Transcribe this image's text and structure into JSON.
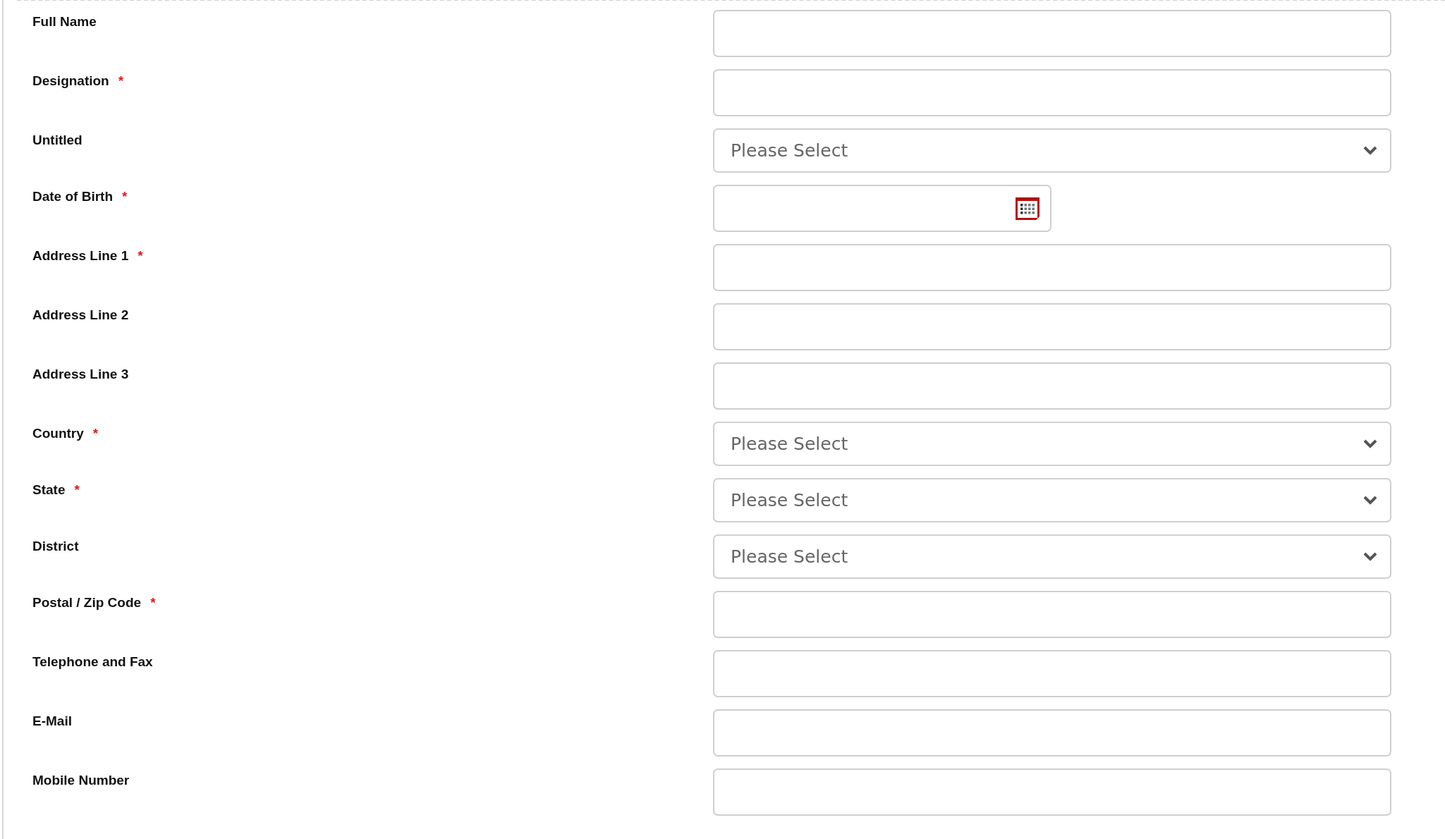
{
  "form": {
    "fields": [
      {
        "label": "Full Name",
        "kind": "text"
      },
      {
        "label": "Designation",
        "marker": "*",
        "kind": "text"
      },
      {
        "label": "Untitled",
        "kind": "select",
        "value": "Please Select"
      },
      {
        "label": "Date of Birth",
        "marker": "*",
        "kind": "date"
      },
      {
        "label": "Address Line 1",
        "marker": "*",
        "kind": "text"
      },
      {
        "label": "Address Line 2",
        "kind": "text"
      },
      {
        "label": "Address Line 3",
        "kind": "text"
      },
      {
        "label": "Country",
        "marker": "*",
        "kind": "select",
        "value": "Please Select"
      },
      {
        "label": "State",
        "marker": "*",
        "kind": "select",
        "value": "Please Select"
      },
      {
        "label": "District",
        "kind": "select",
        "value": "Please Select"
      },
      {
        "label": "Postal / Zip Code",
        "marker": "*",
        "kind": "text"
      },
      {
        "label": "Telephone and Fax",
        "kind": "text"
      },
      {
        "label": "E-Mail",
        "kind": "text"
      },
      {
        "label": "Mobile Number",
        "kind": "text"
      }
    ]
  }
}
